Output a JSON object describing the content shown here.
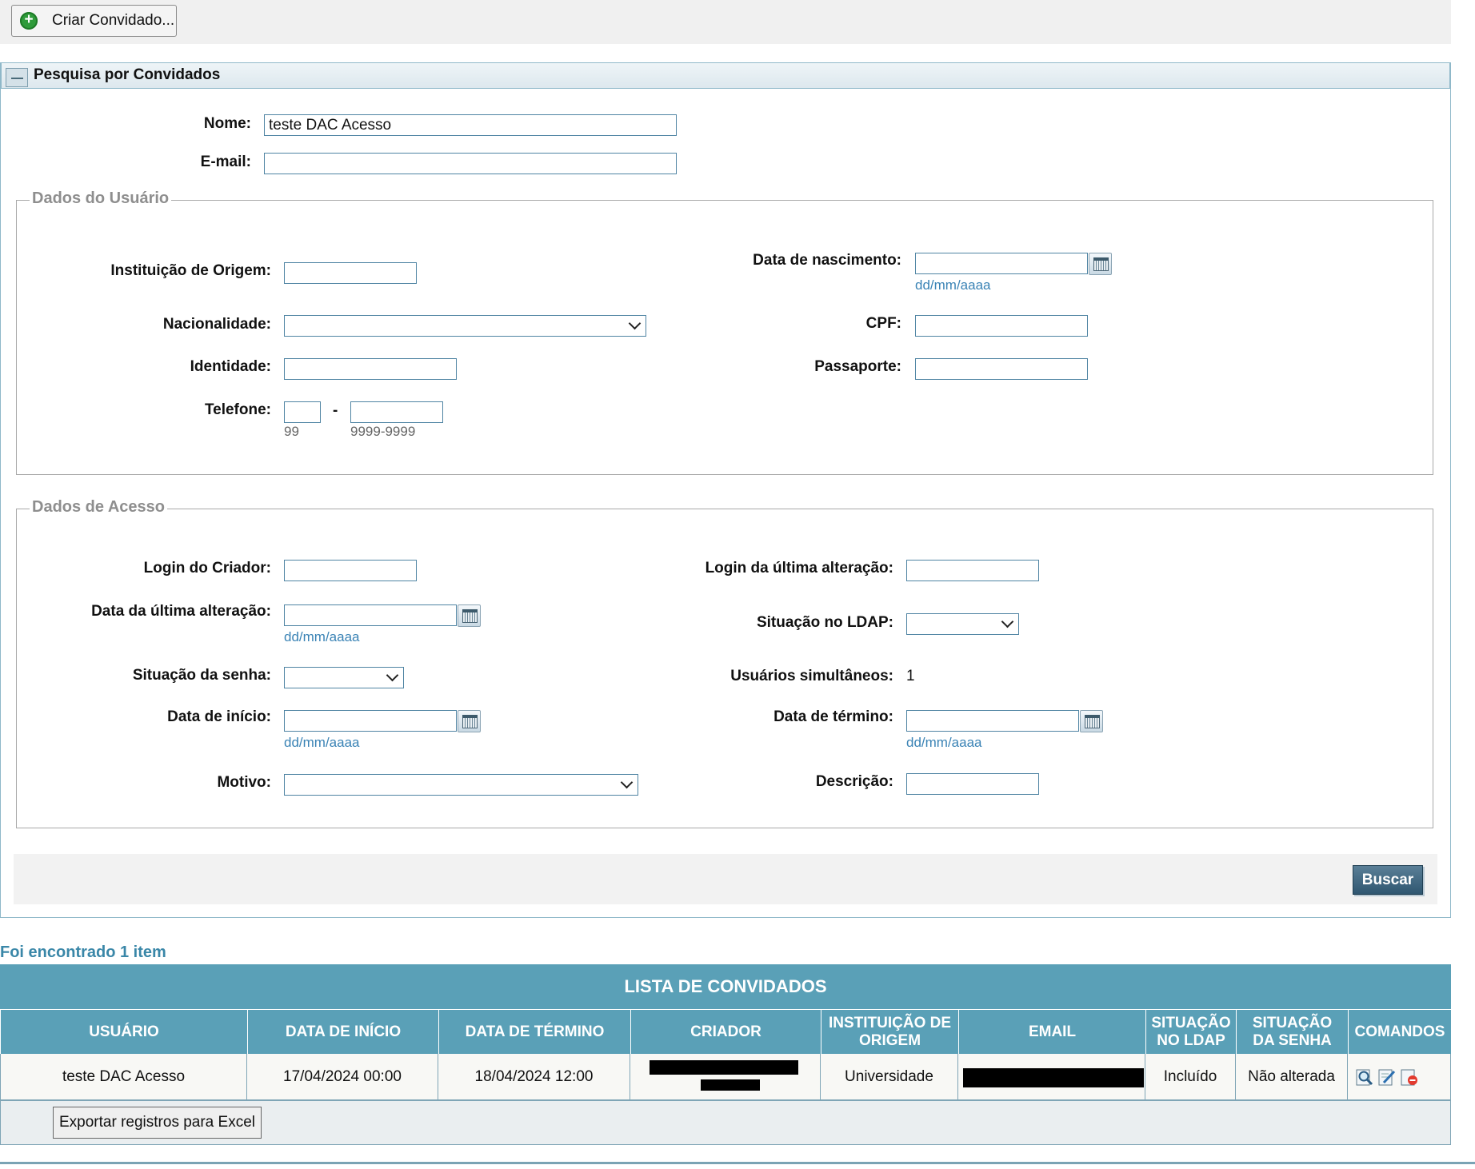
{
  "toolbar": {
    "create_label": "Criar Convidado..."
  },
  "panel": {
    "title": "Pesquisa por Convidados"
  },
  "search": {
    "nome_label": "Nome:",
    "nome_value": "teste DAC Acesso",
    "email_label": "E-mail:",
    "email_value": ""
  },
  "dados_usuario": {
    "legend": "Dados do Usuário",
    "instituicao_label": "Instituição de Origem:",
    "nascimento_label": "Data de nascimento:",
    "date_hint": "dd/mm/aaaa",
    "nacionalidade_label": "Nacionalidade:",
    "cpf_label": "CPF:",
    "identidade_label": "Identidade:",
    "passaporte_label": "Passaporte:",
    "telefone_label": "Telefone:",
    "telefone_sep": "-",
    "ddd_hint": "99",
    "phone_hint": "9999-9999"
  },
  "dados_acesso": {
    "legend": "Dados de Acesso",
    "login_criador_label": "Login do Criador:",
    "login_alteracao_label": "Login da última alteração:",
    "data_alteracao_label": "Data da última alteração:",
    "situacao_ldap_label": "Situação no LDAP:",
    "situacao_senha_label": "Situação da senha:",
    "usuarios_simultaneos_label": "Usuários simultâneos:",
    "usuarios_simultaneos_value": "1",
    "data_inicio_label": "Data de início:",
    "data_termino_label": "Data de término:",
    "motivo_label": "Motivo:",
    "descricao_label": "Descrição:",
    "date_hint": "dd/mm/aaaa"
  },
  "buscar_label": "Buscar",
  "results": {
    "found_text": "Foi encontrado 1 item",
    "list_title": "LISTA DE CONVIDADOS",
    "headers": {
      "usuario": "USUÁRIO",
      "data_inicio": "DATA DE INÍCIO",
      "data_termino": "DATA DE TÉRMINO",
      "criador": "CRIADOR",
      "instituicao_1": "INSTITUIÇÃO DE",
      "instituicao_2": "ORIGEM",
      "email": "EMAIL",
      "ldap_1": "SITUAÇÃO",
      "ldap_2": "NO LDAP",
      "senha_1": "SITUAÇÃO",
      "senha_2": "DA SENHA",
      "comandos": "COMANDOS"
    },
    "rows": [
      {
        "usuario": "teste DAC Acesso",
        "data_inicio": "17/04/2024 00:00",
        "data_termino": "18/04/2024 12:00",
        "instituicao": "Universidade",
        "situacao_ldap": "Incluído",
        "situacao_senha": "Não alterada"
      }
    ],
    "export_label": "Exportar registros para Excel"
  }
}
